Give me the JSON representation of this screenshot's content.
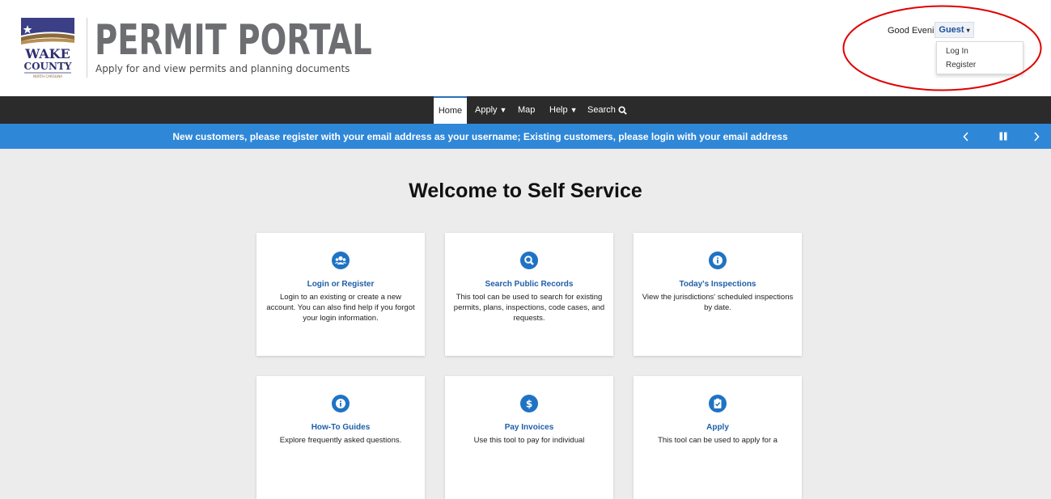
{
  "brand": {
    "logo_text_line1": "WAKE",
    "logo_text_line2": "COUNTY",
    "logo_text_line3": "NORTH CAROLINA",
    "title": "PERMIT PORTAL",
    "subtitle": "Apply for and view permits and planning documents"
  },
  "user": {
    "greeting": "Good Evening,",
    "guest_label": "Guest",
    "menu": [
      "Log In",
      "Register"
    ]
  },
  "nav": {
    "home": "Home",
    "apply": "Apply",
    "map": "Map",
    "help": "Help",
    "search": "Search"
  },
  "banner": {
    "text": "New customers, please register with your email address as your username; Existing customers, please login with your email address"
  },
  "main": {
    "heading": "Welcome to Self Service",
    "cards": [
      {
        "icon": "users-icon",
        "title": "Login or Register",
        "desc": "Login to an existing or create a new account. You can also find help if you forgot your login information."
      },
      {
        "icon": "search-icon",
        "title": "Search Public Records",
        "desc": "This tool can be used to search for existing permits, plans, inspections, code cases, and requests."
      },
      {
        "icon": "info-icon",
        "title": "Today's Inspections",
        "desc": "View the jurisdictions' scheduled inspections by date."
      },
      {
        "icon": "info-icon",
        "title": "How-To Guides",
        "desc": "Explore frequently asked questions."
      },
      {
        "icon": "dollar-icon",
        "title": "Pay Invoices",
        "desc": "Use this tool to pay for individual"
      },
      {
        "icon": "clipboard-check-icon",
        "title": "Apply",
        "desc": "This tool can be used to apply for a"
      }
    ]
  },
  "colors": {
    "accent": "#1f73c4",
    "banner": "#2f87d8",
    "nav": "#2b2b2b",
    "annotation": "#e00000"
  }
}
